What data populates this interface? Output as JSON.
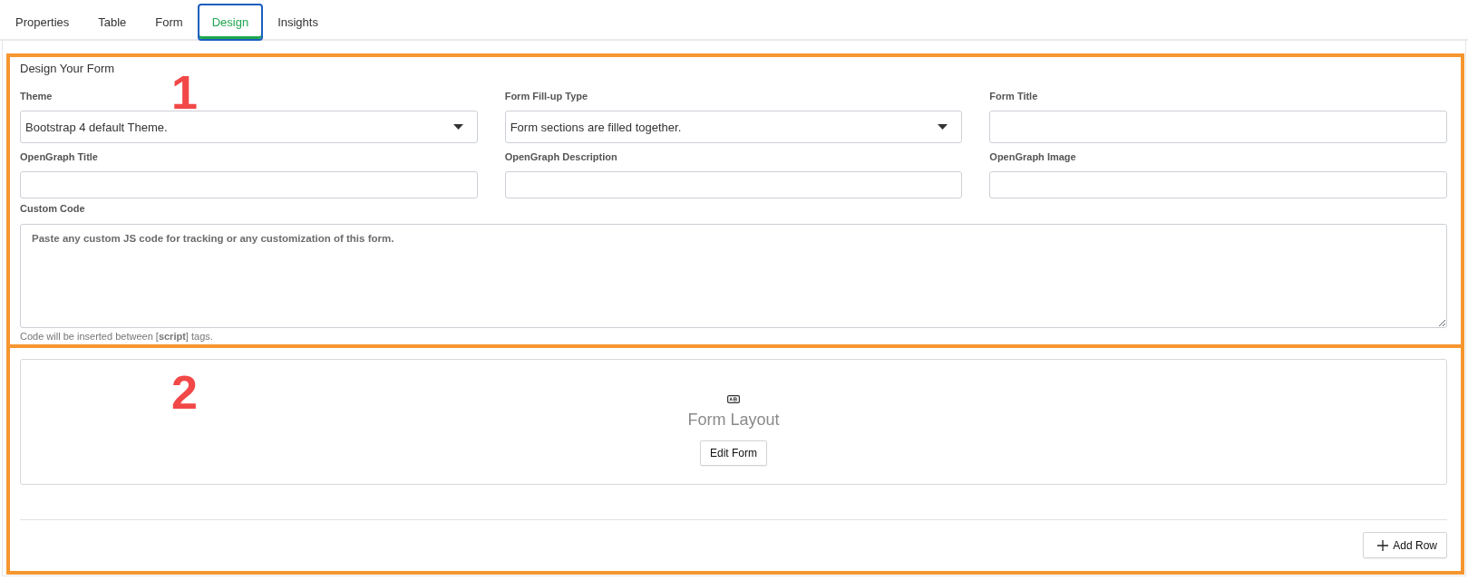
{
  "tabs": [
    {
      "label": "Properties",
      "selected": false
    },
    {
      "label": "Table",
      "selected": false
    },
    {
      "label": "Form",
      "selected": false
    },
    {
      "label": "Design",
      "selected": true
    },
    {
      "label": "Insights",
      "selected": false
    }
  ],
  "design_section": {
    "annotation": "1",
    "title": "Design Your Form",
    "fields": [
      {
        "kind": "select",
        "label": "Theme",
        "value": "Bootstrap 4 default Theme."
      },
      {
        "kind": "select",
        "label": "Form Fill-up Type",
        "value": "Form sections are filled together."
      },
      {
        "kind": "text",
        "label": "Form Title"
      },
      {
        "kind": "text",
        "label": "OpenGraph Title"
      },
      {
        "kind": "text",
        "label": "OpenGraph Description"
      },
      {
        "kind": "text",
        "label": "OpenGraph Image"
      }
    ],
    "custom_code": {
      "label": "Custom Code",
      "placeholder": "Paste any custom JS code for tracking or any customization of this form.",
      "help": "Code will be inserted between [**script**] tags."
    }
  },
  "layout_section": {
    "annotation": "2",
    "title": "Form Layout",
    "edit_button": "Edit Form",
    "add_button": "Add Row"
  }
}
